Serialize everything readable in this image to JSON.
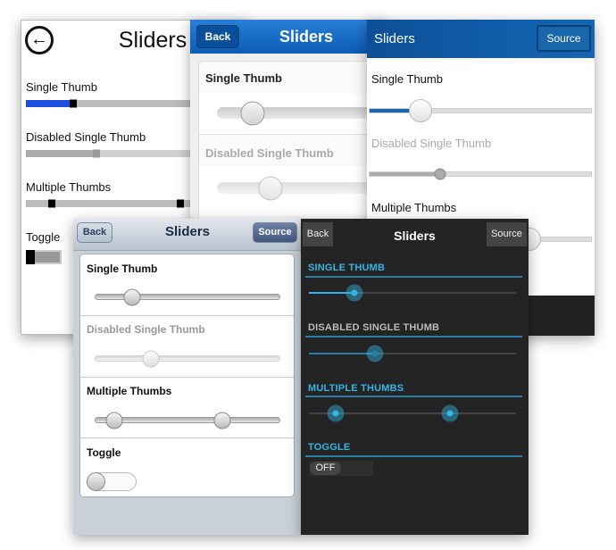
{
  "panels": {
    "windows": {
      "title": "Sliders",
      "back_icon": "arrow-left-circle-icon",
      "labels": {
        "single": "Single Thumb",
        "disabled": "Disabled Single Thumb",
        "multiple": "Multiple Thumbs",
        "toggle": "Toggle"
      },
      "values": {
        "single": 0.22,
        "disabled": 0.33,
        "multiple": [
          0.12,
          0.72
        ],
        "toggle_on": false
      }
    },
    "ios7": {
      "title": "Sliders",
      "back": "Back",
      "labels": {
        "single": "Single Thumb",
        "disabled": "Disabled Single Thumb"
      },
      "values": {
        "single": 0.2,
        "disabled": 0.3
      }
    },
    "blackberry": {
      "title": "Sliders",
      "source": "Source",
      "labels": {
        "single": "Single Thumb",
        "disabled": "Disabled Single Thumb",
        "multiple": "Multiple Thumbs"
      },
      "values": {
        "single": 0.23,
        "disabled": 0.32,
        "multiple": [
          0.72
        ]
      }
    },
    "ios6": {
      "title": "Sliders",
      "back": "Back",
      "source": "Source",
      "labels": {
        "single": "Single Thumb",
        "disabled": "Disabled Single Thumb",
        "multiple": "Multiple Thumbs",
        "toggle": "Toggle"
      },
      "values": {
        "single": 0.2,
        "disabled": 0.3,
        "multiple": [
          0.1,
          0.69
        ],
        "toggle_on": false
      }
    },
    "android": {
      "title": "Sliders",
      "back": "Back",
      "source": "Source",
      "labels": {
        "single": "SINGLE THUMB",
        "disabled": "DISABLED SINGLE THUMB",
        "multiple": "MULTIPLE THUMBS",
        "toggle": "TOGGLE"
      },
      "values": {
        "single": 0.22,
        "disabled": 0.32,
        "multiple": [
          0.13,
          0.68
        ],
        "toggle_on": false
      },
      "toggle_label": "OFF",
      "accent": "#33b5e5"
    }
  }
}
